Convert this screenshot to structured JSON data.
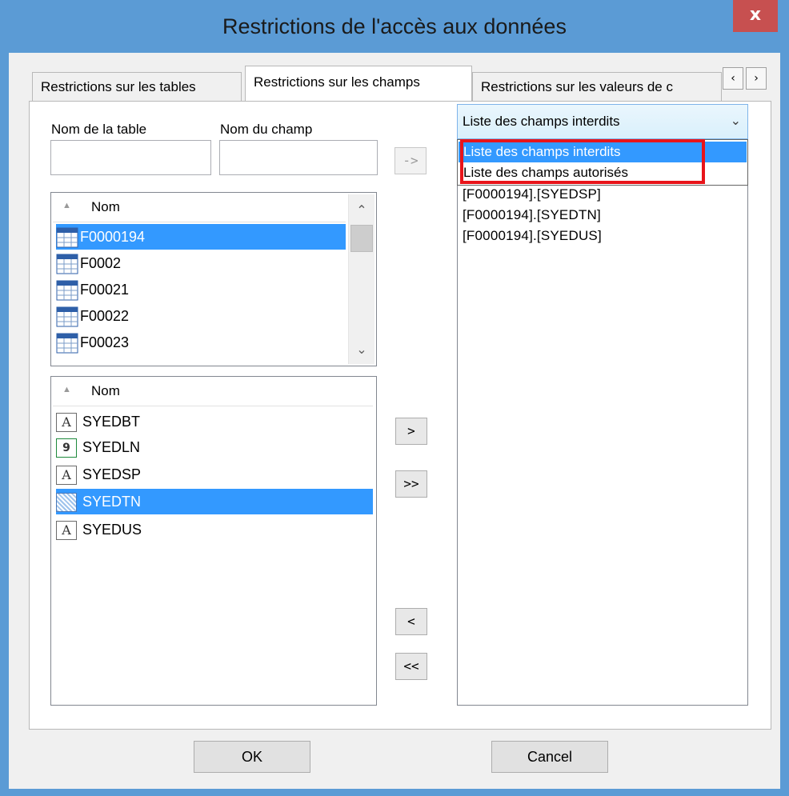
{
  "window": {
    "title": "Restrictions de l'accès aux données",
    "close_label": "x"
  },
  "tabs": [
    {
      "label": "Restrictions sur les tables",
      "active": false
    },
    {
      "label": "Restrictions sur les champs",
      "active": true
    },
    {
      "label": "Restrictions sur les valeurs de c",
      "active": false
    }
  ],
  "tab_scroll": {
    "left": "‹",
    "right": "›"
  },
  "form": {
    "table_name_label": "Nom de la table",
    "field_name_label": "Nom du champ",
    "table_name_value": "",
    "field_name_value": "",
    "filter_button": "->"
  },
  "tables_list": {
    "header": "Nom",
    "sort_icon": "sort-arrow-icon",
    "items": [
      {
        "name": "F0000194",
        "selected": true,
        "icon": "table-icon"
      },
      {
        "name": "F0002",
        "selected": false,
        "icon": "table-icon"
      },
      {
        "name": "F00021",
        "selected": false,
        "icon": "table-icon"
      },
      {
        "name": "F00022",
        "selected": false,
        "icon": "table-icon"
      },
      {
        "name": "F00023",
        "selected": false,
        "icon": "table-icon"
      }
    ]
  },
  "fields_list": {
    "header": "Nom",
    "items": [
      {
        "name": "SYEDBT",
        "type": "text",
        "glyph": "A",
        "selected": false
      },
      {
        "name": "SYEDLN",
        "type": "number",
        "glyph": "9",
        "selected": false
      },
      {
        "name": "SYEDSP",
        "type": "text",
        "glyph": "A",
        "selected": false
      },
      {
        "name": "SYEDTN",
        "type": "blob",
        "glyph": "",
        "selected": true
      },
      {
        "name": "SYEDUS",
        "type": "text",
        "glyph": "A",
        "selected": false
      }
    ]
  },
  "move_buttons": {
    "add": ">",
    "add_all": ">>",
    "remove": "<",
    "remove_all": "<<"
  },
  "mode_combo": {
    "selected": "Liste des champs interdits",
    "options": [
      "Liste des champs interdits",
      "Liste des champs autorisés"
    ]
  },
  "restricted_fields": [
    "[F0000194].[SYEDSP]",
    "[F0000194].[SYEDTN]",
    "[F0000194].[SYEDUS]"
  ],
  "footer": {
    "ok": "OK",
    "cancel": "Cancel"
  },
  "colors": {
    "titlebar": "#5b9bd5",
    "selection": "#3399ff",
    "highlight_box": "#e8141a",
    "close_button": "#c75050"
  }
}
